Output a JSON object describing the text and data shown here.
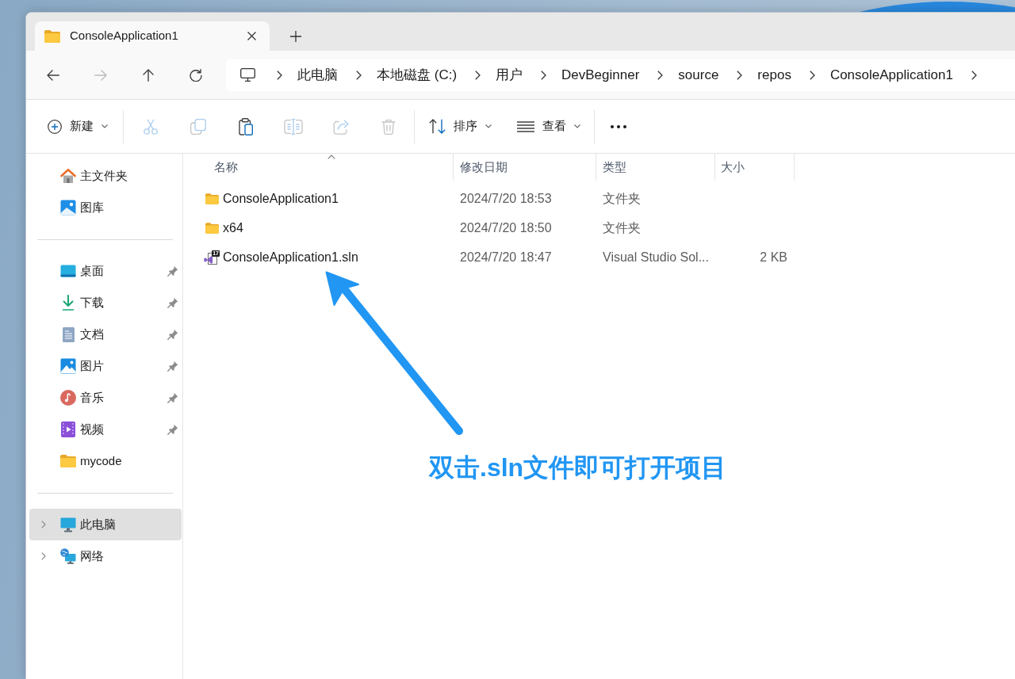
{
  "tabs": [
    {
      "title": "ConsoleApplication1",
      "selected": true
    }
  ],
  "navigation": [
    {
      "kind": "back",
      "disabled": false
    },
    {
      "kind": "forward",
      "disabled": true
    },
    {
      "kind": "up",
      "disabled": false
    },
    {
      "kind": "refresh",
      "disabled": false
    }
  ],
  "address_bar": {
    "crumbs": [
      "此电脑",
      "本地磁盘 (C:)",
      "用户",
      "DevBeginner",
      "source",
      "repos",
      "ConsoleApplication1"
    ]
  },
  "command_groups": [
    {
      "items": [
        {
          "kind": "new",
          "label": "新建",
          "dropdown": true,
          "disabled": false
        }
      ]
    },
    {
      "items": [
        {
          "kind": "cut",
          "disabled": true
        },
        {
          "kind": "copy",
          "disabled": true
        },
        {
          "kind": "paste",
          "disabled": false
        },
        {
          "kind": "rename",
          "disabled": true
        },
        {
          "kind": "share",
          "disabled": true
        },
        {
          "kind": "delete",
          "disabled": true
        }
      ]
    },
    {
      "items": [
        {
          "kind": "sort",
          "label": "排序",
          "dropdown": true,
          "disabled": false
        },
        {
          "kind": "view",
          "label": "查看",
          "dropdown": true,
          "disabled": false
        }
      ]
    },
    {
      "items": [
        {
          "kind": "more",
          "disabled": false
        }
      ]
    }
  ],
  "sidebar": {
    "sections": [
      {
        "items": [
          {
            "kind": "home",
            "label": "主文件夹",
            "selected": false
          },
          {
            "kind": "gallery",
            "label": "图库",
            "selected": false
          }
        ]
      },
      {
        "items": [
          {
            "kind": "desktop",
            "label": "桌面",
            "pinned": true,
            "selected": false
          },
          {
            "kind": "downloads",
            "label": "下载",
            "pinned": true,
            "selected": false
          },
          {
            "kind": "documents",
            "label": "文档",
            "pinned": true,
            "selected": false
          },
          {
            "kind": "pictures",
            "label": "图片",
            "pinned": true,
            "selected": false
          },
          {
            "kind": "music",
            "label": "音乐",
            "pinned": true,
            "selected": false
          },
          {
            "kind": "videos",
            "label": "视频",
            "pinned": true,
            "selected": false
          },
          {
            "kind": "folder",
            "label": "mycode",
            "pinned": false,
            "selected": false
          }
        ]
      },
      {
        "items": [
          {
            "kind": "pc",
            "label": "此电脑",
            "expanded": false,
            "selected": true
          },
          {
            "kind": "network",
            "label": "网络",
            "expanded": false,
            "selected": false
          }
        ]
      }
    ]
  },
  "file_list": {
    "columns": [
      {
        "label": "名称",
        "sorted": true
      },
      {
        "label": "修改日期",
        "sorted": false
      },
      {
        "label": "类型",
        "sorted": false
      },
      {
        "label": "大小",
        "sorted": false
      }
    ],
    "rows": [
      {
        "kind": "folder",
        "name": "ConsoleApplication1",
        "modified": "2024/7/20 18:53",
        "type": "文件夹",
        "selected": false
      },
      {
        "kind": "folder",
        "name": "x64",
        "modified": "2024/7/20 18:50",
        "type": "文件夹",
        "selected": false
      },
      {
        "kind": "solution",
        "name": "ConsoleApplication1.sln",
        "icon_badge": "17",
        "modified": "2024/7/20 18:47",
        "type": "Visual Studio Sol...",
        "size": "2 KB",
        "selected": false
      }
    ]
  },
  "annotation": {
    "text": "双击.sln文件即可打开项目"
  }
}
